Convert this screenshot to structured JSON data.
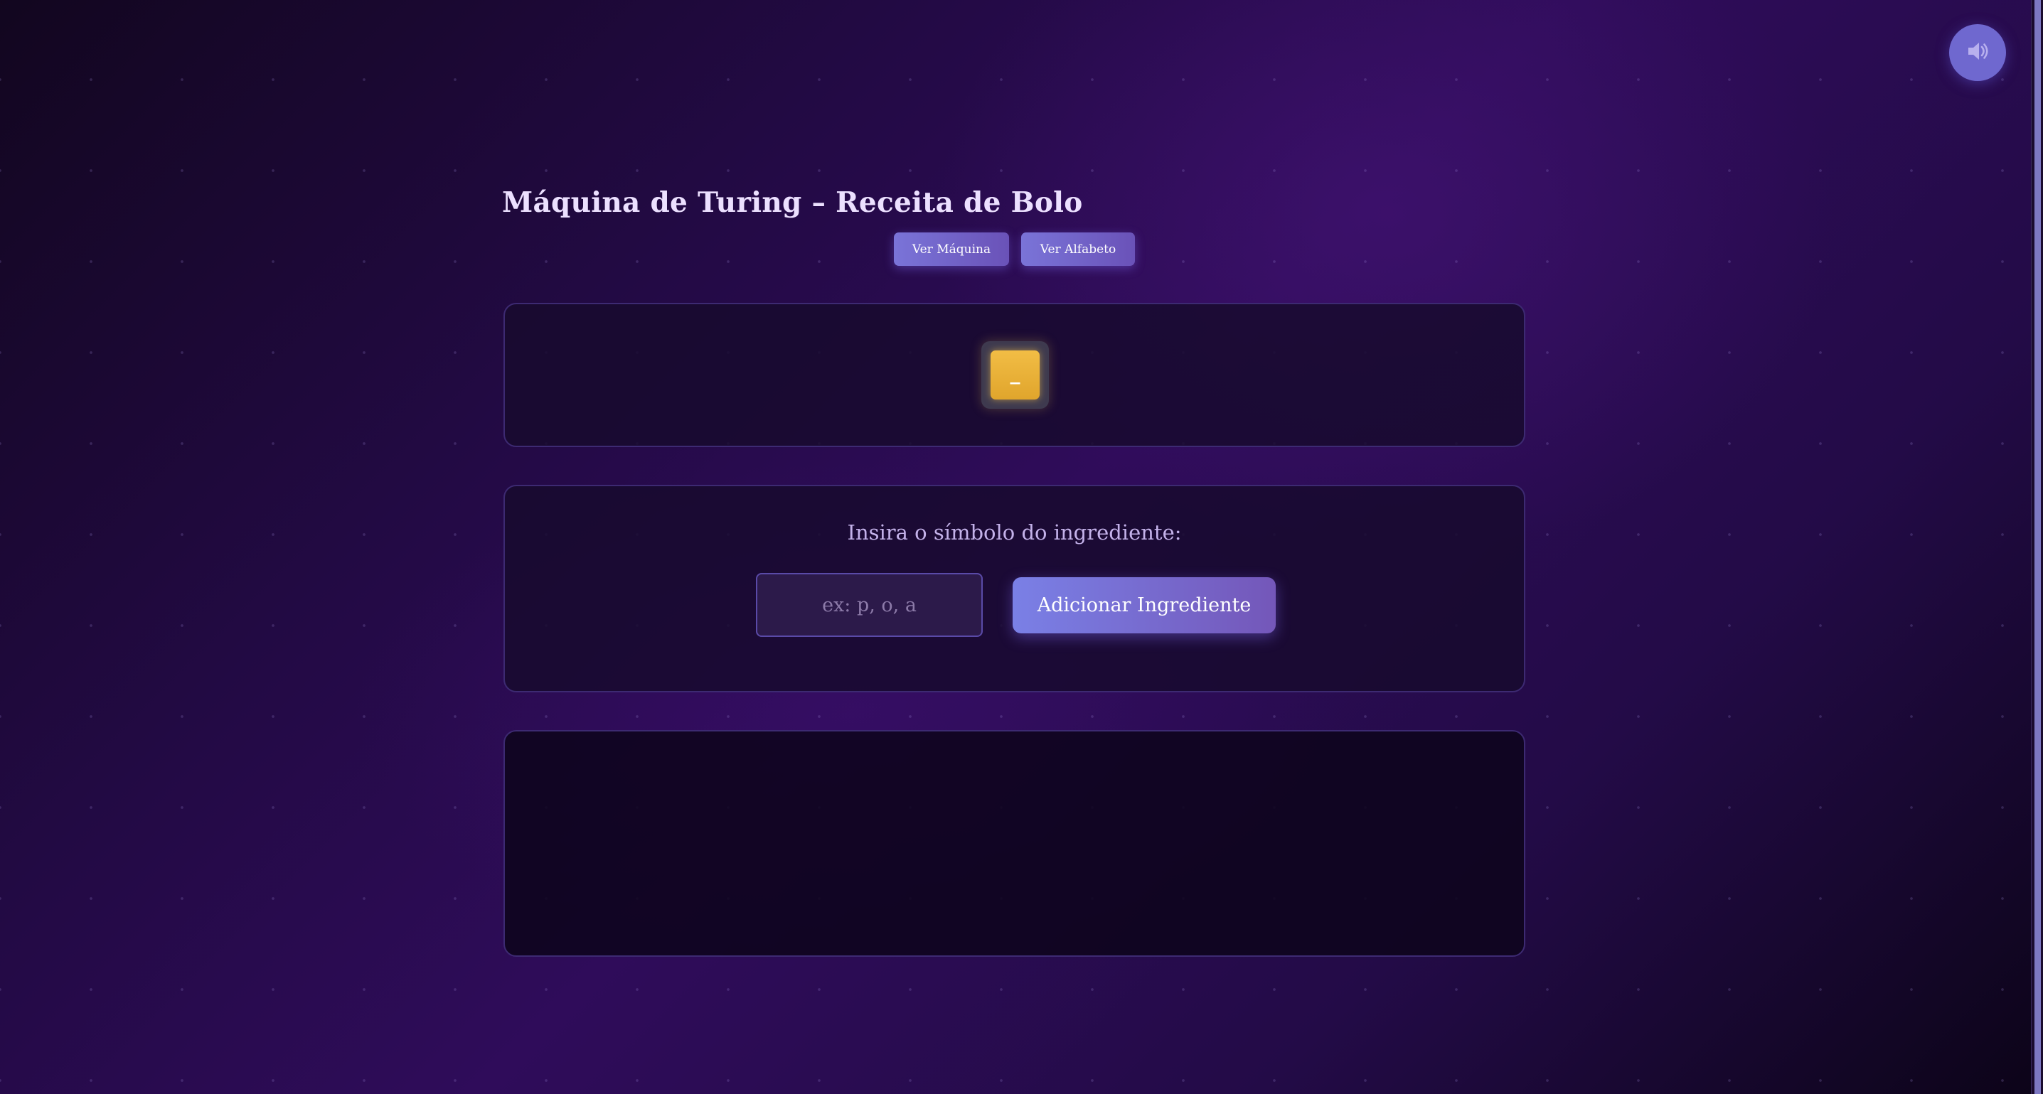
{
  "header": {
    "title": "Máquina de Turing – Receita de Bolo",
    "buttons": {
      "machine_label": "Ver Máquina",
      "alphabet_label": "Ver Alfabeto"
    }
  },
  "sound_toggle": {
    "icon": "speaker-volume-icon"
  },
  "tape": {
    "cells": [
      "_"
    ],
    "active_color": "#f0b53d"
  },
  "ingredient_form": {
    "prompt": "Insira o símbolo do ingrediente:",
    "input_value": "",
    "input_placeholder": "ex: p, o, a",
    "submit_label": "Adicionar Ingrediente"
  },
  "colors": {
    "accent": "#7a74d8",
    "background": "#230a45"
  }
}
